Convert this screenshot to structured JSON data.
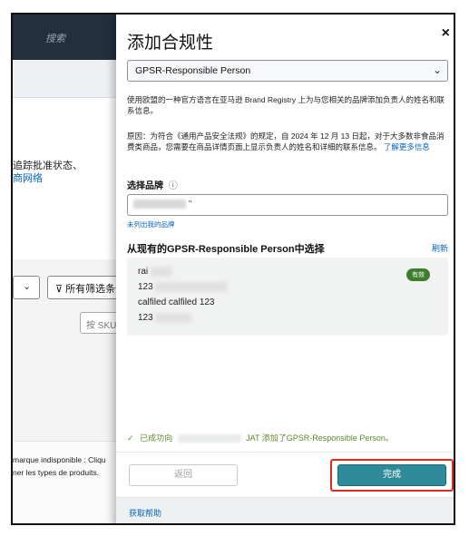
{
  "background": {
    "search_placeholder": "搜索",
    "status_text": "追踪批准状态、",
    "network_link": "商网络",
    "select_chevron": "chevron-down-icon",
    "filter_label": "所有筛选条件",
    "sku_placeholder": "按 SKU、",
    "french_line1": "marque indisponible : Cliqu",
    "french_line2": "ner les types de produits."
  },
  "modal": {
    "title": "添加合规性",
    "close_icon": "×",
    "compliance_select": {
      "value": "GPSR-Responsible Person",
      "chevron": "⌄"
    },
    "description": "使用欧盟的一种官方语言在亚马逊 Brand Registry 上为与您相关的品牌添加负责人的姓名和联系信息。",
    "reason_text": "原因：为符合《通用产品安全法规》的规定，自 2024 年 12 月 13 日起，对于大多数非食品消费类商品，您需要在商品详情页面上显示负责人的姓名和详细的联系信息。",
    "learn_more": "了解更多信息",
    "brand": {
      "label": "选择品牌",
      "help_icon": "ⓘ",
      "input_value": "\"",
      "not_listed_link": "未列出我的品牌"
    },
    "choose_heading": "从现有的GPSR-Responsible Person中选择",
    "refresh_link": "刷新",
    "person_card": {
      "line1": "rai",
      "line2": "123",
      "line3": "calfiled calfiled 123",
      "line4": "123",
      "badge": "有效"
    },
    "success": {
      "check": "✓",
      "prefix": "已成功向",
      "suffix": "JAT 添加了GPSR-Responsible Person。"
    },
    "back_button": "返回",
    "done_button": "完成",
    "help_link": "获取帮助"
  },
  "colors": {
    "accent_teal": "#2f8b99",
    "link_blue": "#0066c0",
    "success_green": "#5a8a2b",
    "highlight_red": "#e02b1e",
    "badge_green": "#3f7d2e"
  }
}
